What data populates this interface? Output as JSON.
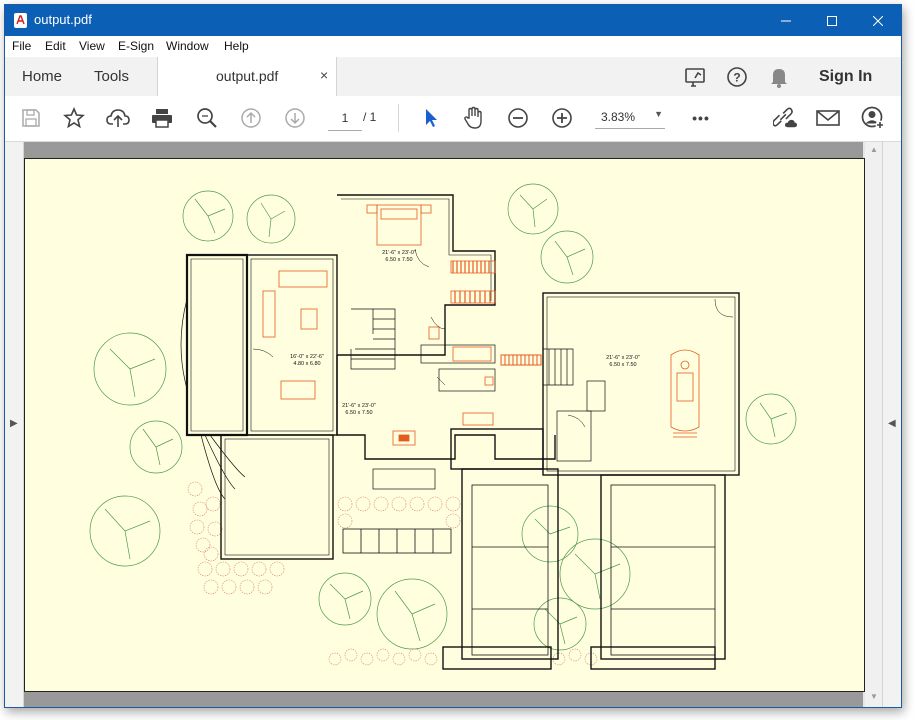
{
  "window": {
    "title": "output.pdf",
    "minimize_icon": "minimize-icon",
    "maximize_icon": "maximize-icon",
    "close_icon": "close-icon"
  },
  "menu": [
    "File",
    "Edit",
    "View",
    "E-Sign",
    "Window",
    "Help"
  ],
  "tabs": {
    "home": "Home",
    "tools": "Tools",
    "document": "output.pdf",
    "close_symbol": "×"
  },
  "header_right": {
    "share_icon": "share-screen-icon",
    "help_icon": "help-icon",
    "notifications_icon": "bell-icon",
    "sign_in": "Sign In"
  },
  "toolbar": {
    "page_current": "1",
    "page_total": "/ 1",
    "zoom": "3.83%",
    "more": "•••"
  },
  "document": {
    "rooms": [
      {
        "dims": "21'-6\" x 23'-0\"",
        "metric": "6.50 x 7.50"
      },
      {
        "dims": "16'-0\" x 22'-6\"",
        "metric": "4.80 x 6.80"
      },
      {
        "dims": "21'-6\" x 23'-0\"",
        "metric": "6.50 x 7.50"
      },
      {
        "dims": "21'-6\" x 23'-0\"",
        "metric": "6.50 x 7.50"
      }
    ]
  },
  "colors": {
    "titlebar": "#0b5fb4",
    "page_bg": "#ffffe0",
    "accent_blue": "#1a5fd0",
    "furniture_orange": "#e65a1e",
    "tree_green": "#4c9a4c"
  }
}
